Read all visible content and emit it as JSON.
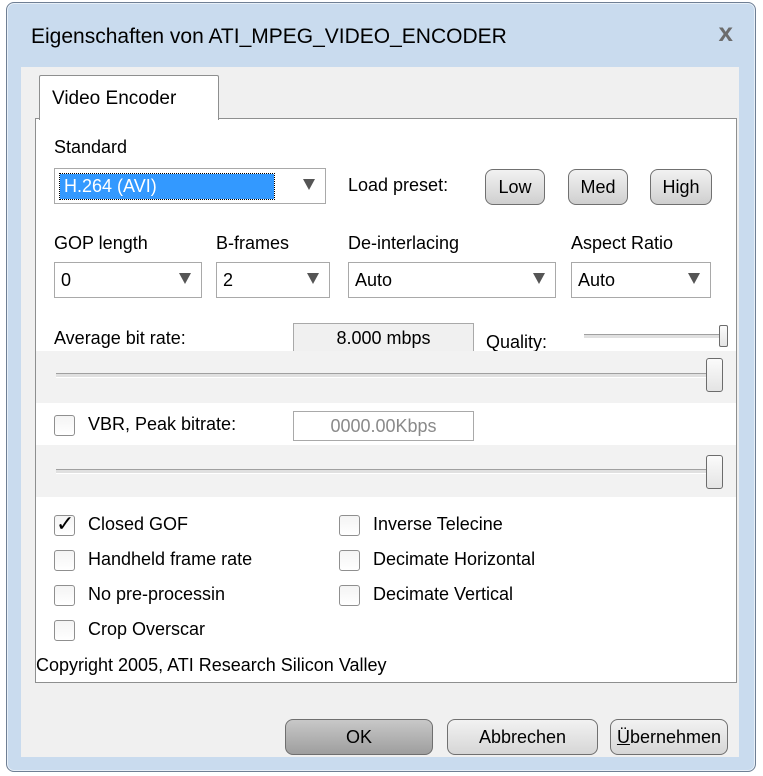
{
  "window": {
    "title": "Eigenschaften von ATI_MPEG_VIDEO_ENCODER",
    "close_glyph": "x"
  },
  "tab": {
    "label": "Video Encoder"
  },
  "standard": {
    "label": "Standard",
    "value": "H.264 (AVI)"
  },
  "preset": {
    "label": "Load preset:",
    "low": "Low",
    "med": "Med",
    "high": "High"
  },
  "gop": {
    "label": "GOP length",
    "value": "0"
  },
  "bframes": {
    "label": "B-frames",
    "value": "2"
  },
  "deinterlacing": {
    "label": "De-interlacing",
    "value": "Auto"
  },
  "aspect": {
    "label": "Aspect Ratio",
    "value": "Auto"
  },
  "bitrate": {
    "label": "Average bit rate:",
    "value": "8.000 mbps",
    "quality_label": "Quality:",
    "slider_level": 1.0,
    "quality_level": 1.0
  },
  "vbr": {
    "label": "VBR, Peak bitrate:",
    "value": "0000.00Kbps",
    "checked": false,
    "slider_level": 1.0
  },
  "options_left": [
    {
      "label": "Closed GOF",
      "checked": true
    },
    {
      "label": "Handheld frame rate",
      "checked": false
    },
    {
      "label": "No pre-processin",
      "checked": false
    },
    {
      "label": "Crop Overscar",
      "checked": false
    }
  ],
  "options_right": [
    {
      "label": "Inverse Telecine",
      "checked": false
    },
    {
      "label": "Decimate Horizontal",
      "checked": false
    },
    {
      "label": "Decimate Vertical",
      "checked": false
    }
  ],
  "copyright": "Copyright 2005, ATI Research Silicon Valley",
  "buttons": {
    "ok": "OK",
    "cancel": "Abbrechen",
    "apply_first": "Ü",
    "apply_rest": "bernehmen"
  },
  "colors": {
    "frame": "#c9dbee",
    "selection": "#3399ff"
  }
}
